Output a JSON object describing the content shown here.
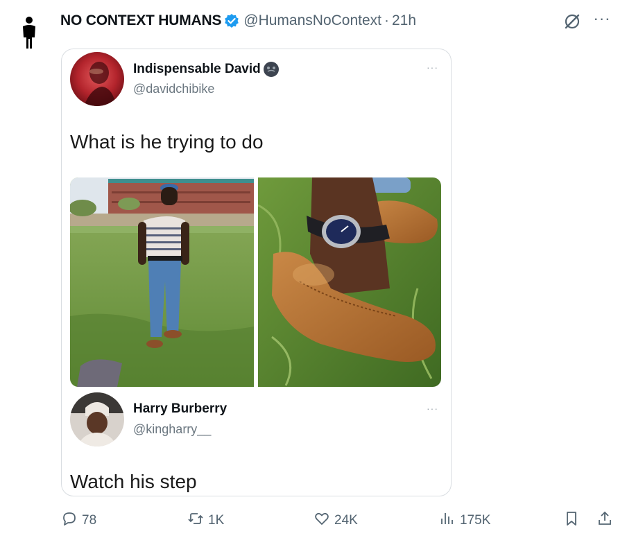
{
  "tweet": {
    "display_name": "NO CONTEXT HUMANS",
    "handle": "@HumansNoContext",
    "separator": "·",
    "time": "21h",
    "more": "···"
  },
  "quote": {
    "author1": {
      "name": "Indispensable David",
      "handle": "@davidchibike",
      "more": "···",
      "text": "What is he trying to do"
    },
    "author2": {
      "name": "Harry Burberry",
      "handle": "@kingharry__",
      "more": "···",
      "text": "Watch his step"
    }
  },
  "actions": {
    "replies": "78",
    "reposts": "1K",
    "likes": "24K",
    "views": "175K"
  },
  "colors": {
    "verified": "#1d9bf0",
    "text_secondary": "#536471",
    "border": "#d9dde1"
  },
  "icons": [
    "person-icon",
    "verified-badge-icon",
    "grok-icon",
    "more-icon",
    "reply-icon",
    "repost-icon",
    "like-icon",
    "views-icon",
    "bookmark-icon",
    "share-icon"
  ]
}
